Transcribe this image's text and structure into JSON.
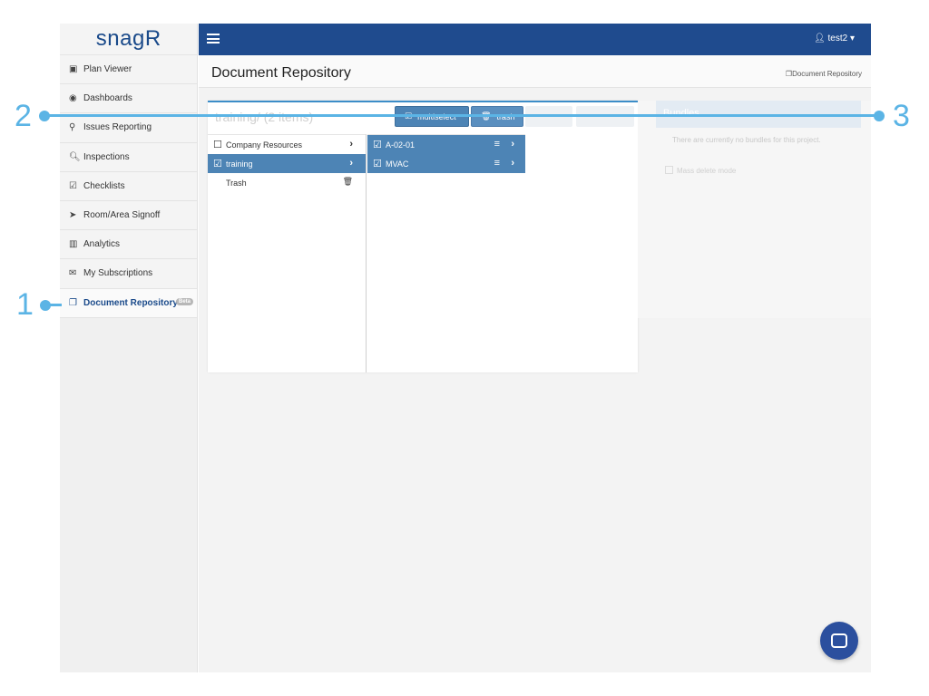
{
  "brand": {
    "logo_main": "snag",
    "logo_r": "R"
  },
  "user": {
    "name": "test2"
  },
  "sidebar": {
    "items": [
      {
        "label": "Plan Viewer",
        "icon": "image-icon"
      },
      {
        "label": "Dashboards",
        "icon": "dashboard-icon"
      },
      {
        "label": "Issues Reporting",
        "icon": "map-marker-icon"
      },
      {
        "label": "Inspections",
        "icon": "search-icon"
      },
      {
        "label": "Checklists",
        "icon": "checkbox-icon"
      },
      {
        "label": "Room/Area Signoff",
        "icon": "location-arrow-icon"
      },
      {
        "label": "Analytics",
        "icon": "bar-chart-icon"
      },
      {
        "label": "My Subscriptions",
        "icon": "envelope-icon"
      },
      {
        "label": "Document Repository",
        "icon": "copy-icon",
        "badge": "Beta",
        "active": true
      }
    ]
  },
  "page": {
    "title": "Document Repository",
    "breadcrumb": "Document Repository"
  },
  "repo": {
    "path_title": "training/ (2 items)",
    "toolbar": {
      "multiselect_label": "multiselect",
      "trash_label": "trash"
    },
    "tree": [
      {
        "label": "Company Resources",
        "checked": false
      },
      {
        "label": "training",
        "checked": true
      },
      {
        "label": "Trash"
      }
    ],
    "files": [
      {
        "label": "A-02-01",
        "checked": true
      },
      {
        "label": "MVAC",
        "checked": true
      }
    ]
  },
  "bundles": {
    "title": "Bundles",
    "empty_text": "There are currently no bundles for this project.",
    "mass_delete_label": "Mass delete mode"
  },
  "annotations": {
    "one": "1",
    "two": "2",
    "three": "3"
  },
  "colors": {
    "primary": "#1f4b8e",
    "selected": "#4d84b5",
    "annotation": "#5bb4e5"
  }
}
